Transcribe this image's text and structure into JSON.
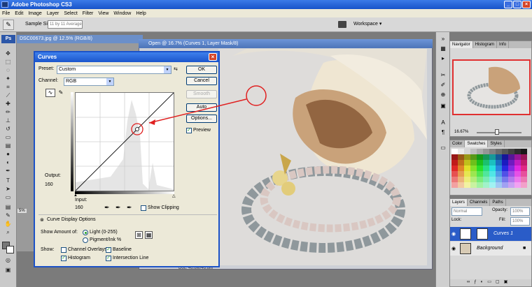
{
  "app": {
    "title": "Adobe Photoshop CS3"
  },
  "menu": [
    "File",
    "Edit",
    "Image",
    "Layer",
    "Select",
    "Filter",
    "View",
    "Window",
    "Help"
  ],
  "options": {
    "sample_size_label": "Sample Size:",
    "sample_size_value": "11 by 11 Average",
    "workspace": "Workspace"
  },
  "toolbox": {
    "badge": "Ps"
  },
  "documents": {
    "back_title": "DSC00673.jpg @ 12.5% (RGB/8)",
    "front_title": "Open @ 16.7% (Curves 1, Layer Mask/8)",
    "zoom_back": "5%",
    "status": "Doc: 46.8M/46.8M"
  },
  "curves": {
    "title": "Curves",
    "preset_label": "Preset:",
    "preset_value": "Custom",
    "channel_label": "Channel:",
    "channel_value": "RGB",
    "ok": "OK",
    "cancel": "Cancel",
    "smooth": "Smooth",
    "auto": "Auto",
    "options": "Options...",
    "preview": "Preview",
    "output_label": "Output:",
    "output_value": "160",
    "input_label": "Input:",
    "input_value": "160",
    "show_clipping": "Show Clipping",
    "display_options": "Curve Display Options",
    "show_amount": "Show Amount of:",
    "light": "Light  (0-255)",
    "pigment": "Pigment/Ink %",
    "show": "Show:",
    "channel_overlays": "Channel Overlays",
    "baseline": "Baseline",
    "histogram": "Histogram",
    "intersection": "Intersection Line"
  },
  "navigator": {
    "tabs": [
      "Navigator",
      "Histogram",
      "Info"
    ],
    "zoom": "16.67%"
  },
  "color_panel": {
    "tabs": [
      "Color",
      "Swatches",
      "Styles"
    ]
  },
  "layers": {
    "tabs": [
      "Layers",
      "Channels",
      "Paths"
    ],
    "blend_mode": "Normal",
    "opacity_label": "Opacity:",
    "opacity_value": "100%",
    "lock_label": "Lock:",
    "fill_label": "Fill:",
    "fill_value": "100%",
    "layer1": "Curves 1",
    "layer2": "Background"
  },
  "colors": {
    "accent": "#1c52c7",
    "annotation": "#e02020"
  }
}
